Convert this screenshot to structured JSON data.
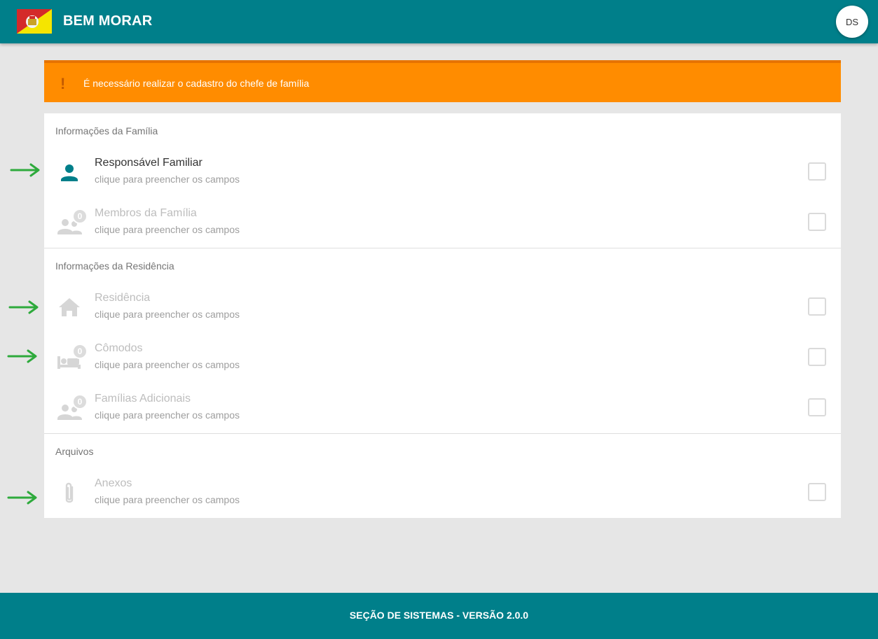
{
  "colors": {
    "primary": "#007f8a",
    "alert": "#ff8c00",
    "arrow": "#2eaa3c",
    "icon_active": "#007f8a",
    "icon_disabled": "#d6d6d6"
  },
  "header": {
    "title": "BEM MORAR",
    "avatar_initials": "DS"
  },
  "alert": {
    "icon": "!",
    "message": "É necessário realizar o cadastro do chefe de família"
  },
  "sections": {
    "familia": {
      "title": "Informações da Família",
      "items": [
        {
          "title": "Responsável Familiar",
          "subtitle": "clique para preencher os campos",
          "icon": "person-icon"
        },
        {
          "title": "Membros da Família",
          "subtitle": "clique para preencher os campos",
          "icon": "group-icon",
          "badge": "0"
        }
      ]
    },
    "residencia": {
      "title": "Informações da Residência",
      "items": [
        {
          "title": "Residência",
          "subtitle": "clique para preencher os campos",
          "icon": "home-icon"
        },
        {
          "title": "Cômodos",
          "subtitle": "clique para preencher os campos",
          "icon": "bed-icon",
          "badge": "0"
        },
        {
          "title": "Famílias Adicionais",
          "subtitle": "clique para preencher os campos",
          "icon": "group-icon",
          "badge": "0"
        }
      ]
    },
    "arquivos": {
      "title": "Arquivos",
      "items": [
        {
          "title": "Anexos",
          "subtitle": "clique para preencher os campos",
          "icon": "paperclip-icon"
        }
      ]
    }
  },
  "footer": {
    "text": "SEÇÃO DE SISTEMAS - VERSÃO 2.0.0"
  }
}
